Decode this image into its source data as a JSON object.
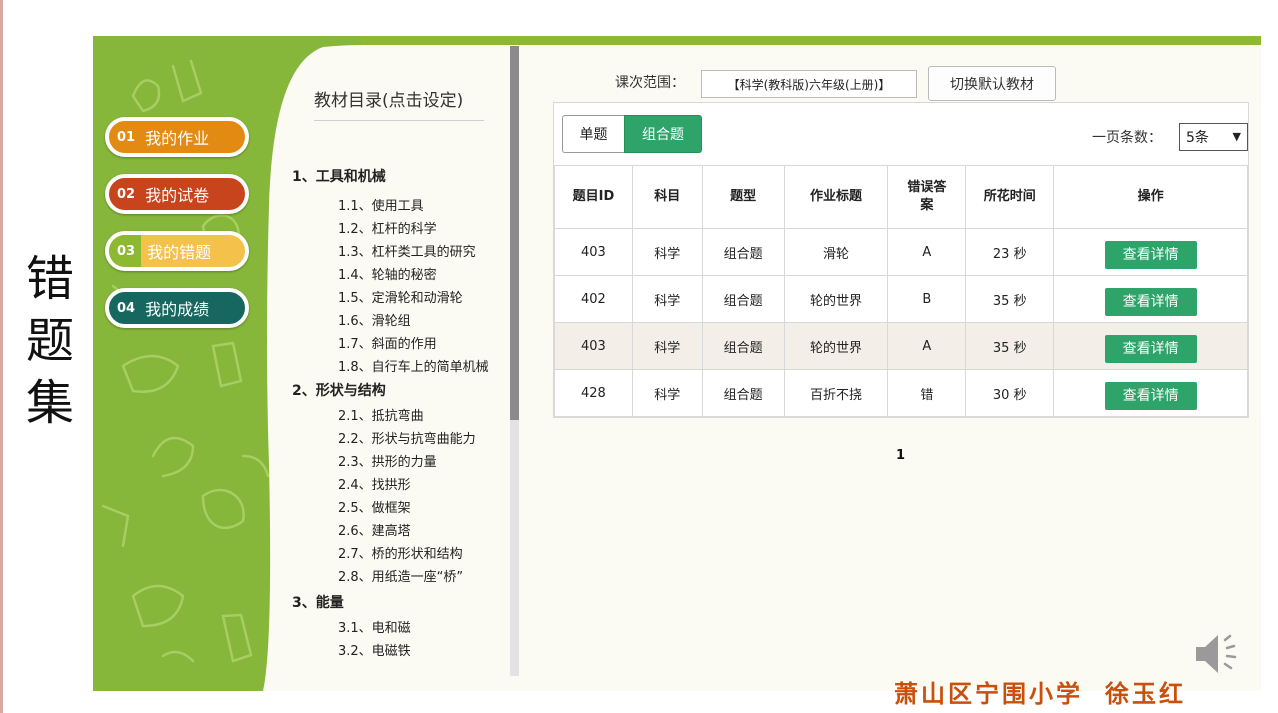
{
  "slide": {
    "vertical_title": [
      "错",
      "题",
      "集"
    ],
    "school": "萧山区宁围小学",
    "author": "徐玉红"
  },
  "sidebar": {
    "items": [
      {
        "num": "01",
        "label": "我的作业",
        "color": "#e38a13"
      },
      {
        "num": "02",
        "label": "我的试卷",
        "color": "#c7441d"
      },
      {
        "num": "03",
        "label": "我的错题",
        "color": "#f4c14a",
        "active": true
      },
      {
        "num": "04",
        "label": "我的成绩",
        "color": "#15675f"
      }
    ]
  },
  "catalog": {
    "title": "教材目录(点击设定)",
    "chapters": [
      {
        "label": "1、工具和机械",
        "lessons": [
          "1.1、使用工具",
          "1.2、杠杆的科学",
          "1.3、杠杆类工具的研究",
          "1.4、轮轴的秘密",
          "1.5、定滑轮和动滑轮",
          "1.6、滑轮组",
          "1.7、斜面的作用",
          "1.8、自行车上的简单机械"
        ]
      },
      {
        "label": "2、形状与结构",
        "lessons": [
          "2.1、抵抗弯曲",
          "2.2、形状与抗弯曲能力",
          "2.3、拱形的力量",
          "2.4、找拱形",
          "2.5、做框架",
          "2.6、建高塔",
          "2.7、桥的形状和结构",
          "2.8、用纸造一座“桥”"
        ]
      },
      {
        "label": "3、能量",
        "lessons": [
          "3.1、电和磁",
          "3.2、电磁铁"
        ]
      }
    ]
  },
  "scope": {
    "label": "课次范围：",
    "value": "【科学(教科版)六年级(上册)】",
    "switch_button": "切换默认教材"
  },
  "tabs": {
    "single": "单题",
    "group": "组合题",
    "active": "group"
  },
  "per_page": {
    "label": "一页条数：",
    "value": "5条"
  },
  "table": {
    "headers": [
      "题目ID",
      "科目",
      "题型",
      "作业标题",
      "错误答案",
      "所花时间",
      "操作"
    ],
    "rows": [
      {
        "id": "403",
        "subject": "科学",
        "type": "组合题",
        "title": "滑轮",
        "wrong": "A",
        "time": "23 秒",
        "action": "查看详情"
      },
      {
        "id": "402",
        "subject": "科学",
        "type": "组合题",
        "title": "轮的世界",
        "wrong": "B",
        "time": "35 秒",
        "action": "查看详情"
      },
      {
        "id": "403",
        "subject": "科学",
        "type": "组合题",
        "title": "轮的世界",
        "wrong": "A",
        "time": "35 秒",
        "action": "查看详情",
        "highlighted": true
      },
      {
        "id": "428",
        "subject": "科学",
        "type": "组合题",
        "title": "百折不挠",
        "wrong": "错",
        "time": "30 秒",
        "action": "查看详情"
      }
    ]
  },
  "pagination": {
    "current": "1"
  },
  "icons": {
    "speaker": "speaker-icon",
    "select_caret": "caret-down-icon"
  },
  "colors": {
    "panel_green": "#86b63a",
    "button_green": "#2ea36a",
    "signature": "#c9500c"
  }
}
